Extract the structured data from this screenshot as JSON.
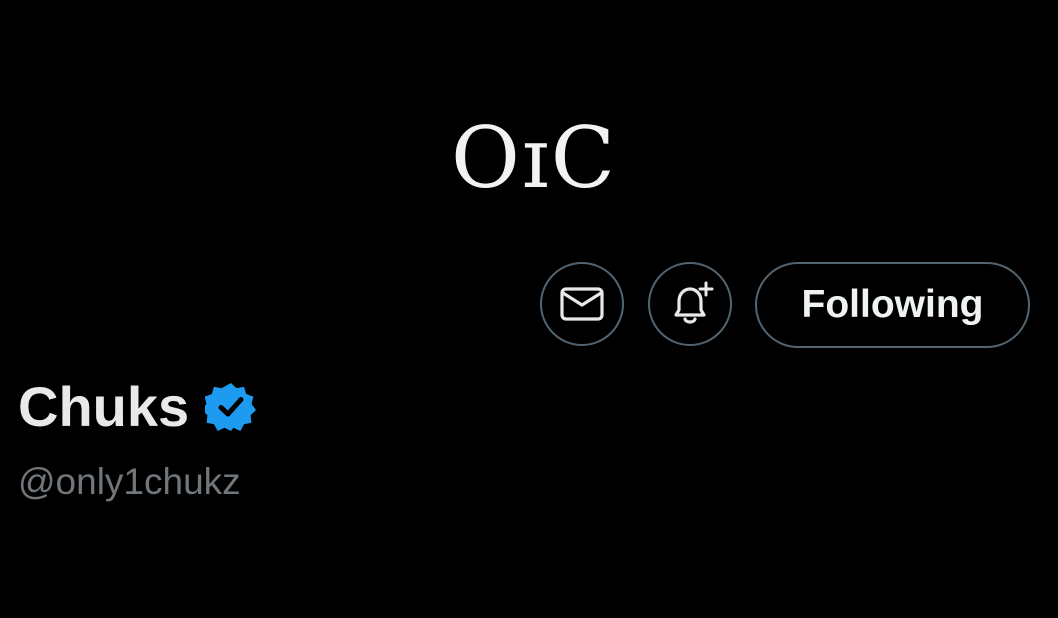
{
  "banner": {
    "logo_text": "OɪC"
  },
  "actions": {
    "message_icon": "mail-icon",
    "notify_icon": "bell-plus-icon",
    "following_label": "Following"
  },
  "profile": {
    "display_name": "Chuks",
    "verified_icon": "verified-badge-icon",
    "handle": "@only1chukz"
  },
  "colors": {
    "background": "#000000",
    "border": "#536471",
    "verified_blue": "#1d9bf0",
    "name_text": "#e7e9ea",
    "handle_text": "#71767b"
  }
}
